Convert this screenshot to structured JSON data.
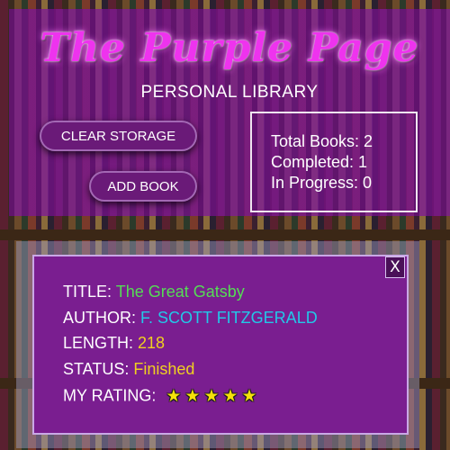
{
  "header": {
    "title": "The Purple Page",
    "subtitle": "PERSONAL LIBRARY"
  },
  "actions": {
    "clear_label": "CLEAR STORAGE",
    "add_label": "ADD BOOK"
  },
  "stats": {
    "total": "Total Books: 2",
    "completed": "Completed: 1",
    "in_progress": "In Progress: 0"
  },
  "book": {
    "close_label": "X",
    "title_label": "TITLE:",
    "title": "The Great Gatsby",
    "author_label": "AUTHOR:",
    "author": "F. SCOTT FITZGERALD",
    "length_label": "LENGTH:",
    "length": "218",
    "status_label": "STATUS:",
    "status": "Finished",
    "rating_label": "MY RATING:",
    "rating": 5,
    "rating_max": 5,
    "star_glyph": "★"
  },
  "colors": {
    "accent": "#ee33ee",
    "header_bg": "#78148c",
    "title_value": "#55dd55",
    "author_value": "#22c8e8",
    "meta_value": "#f0d020",
    "star": "#f5e20a"
  }
}
